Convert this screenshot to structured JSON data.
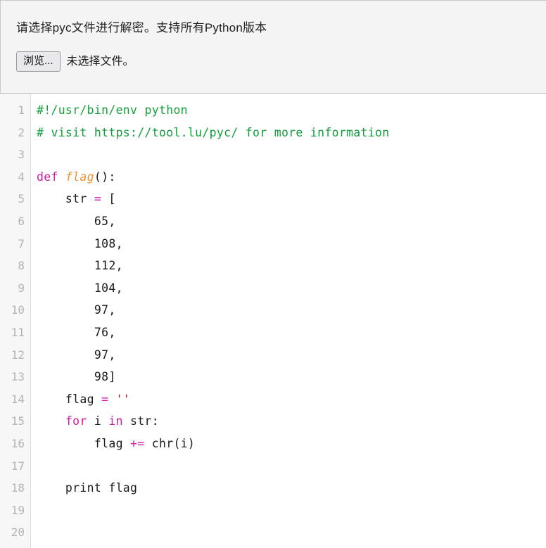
{
  "upload_panel": {
    "heading": "请选择pyc文件进行解密。支持所有Python版本",
    "browse_label": "浏览...",
    "file_status": "未选择文件。"
  },
  "code_viewer": {
    "language": "python",
    "first_line_number": 1,
    "last_line_number": 20,
    "line_numbers": [
      "1",
      "2",
      "3",
      "4",
      "5",
      "6",
      "7",
      "8",
      "9",
      "10",
      "11",
      "12",
      "13",
      "14",
      "15",
      "16",
      "17",
      "18",
      "19",
      "20"
    ],
    "colors": {
      "comment": "#12a03c",
      "keyword": "#d119a8",
      "function_name": "#e89132",
      "operator": "#d119a8",
      "string": "#b02020",
      "plain": "#1b1b1b",
      "gutter_text": "#b3b3b3",
      "gutter_bg": "#f7f7f7",
      "panel_bg": "#f4f4f4"
    },
    "lines": [
      {
        "n": "1",
        "tokens": [
          {
            "t": "#!/usr/bin/env python",
            "c": "comment"
          }
        ]
      },
      {
        "n": "2",
        "tokens": [
          {
            "t": "# visit https://tool.lu/pyc/ for more information",
            "c": "comment"
          }
        ]
      },
      {
        "n": "3",
        "tokens": [
          {
            "t": "",
            "c": "plain"
          }
        ]
      },
      {
        "n": "4",
        "tokens": [
          {
            "t": "def",
            "c": "keyword"
          },
          {
            "t": " ",
            "c": "plain"
          },
          {
            "t": "flag",
            "c": "fname"
          },
          {
            "t": "():",
            "c": "plain"
          }
        ]
      },
      {
        "n": "5",
        "tokens": [
          {
            "t": "    str ",
            "c": "plain"
          },
          {
            "t": "=",
            "c": "op"
          },
          {
            "t": " [",
            "c": "plain"
          }
        ]
      },
      {
        "n": "6",
        "tokens": [
          {
            "t": "        65,",
            "c": "plain"
          }
        ]
      },
      {
        "n": "7",
        "tokens": [
          {
            "t": "        108,",
            "c": "plain"
          }
        ]
      },
      {
        "n": "8",
        "tokens": [
          {
            "t": "        112,",
            "c": "plain"
          }
        ]
      },
      {
        "n": "9",
        "tokens": [
          {
            "t": "        104,",
            "c": "plain"
          }
        ]
      },
      {
        "n": "10",
        "tokens": [
          {
            "t": "        97,",
            "c": "plain"
          }
        ]
      },
      {
        "n": "11",
        "tokens": [
          {
            "t": "        76,",
            "c": "plain"
          }
        ]
      },
      {
        "n": "12",
        "tokens": [
          {
            "t": "        97,",
            "c": "plain"
          }
        ]
      },
      {
        "n": "13",
        "tokens": [
          {
            "t": "        98]",
            "c": "plain"
          }
        ]
      },
      {
        "n": "14",
        "tokens": [
          {
            "t": "    flag ",
            "c": "plain"
          },
          {
            "t": "=",
            "c": "op"
          },
          {
            "t": " ",
            "c": "plain"
          },
          {
            "t": "''",
            "c": "string"
          }
        ]
      },
      {
        "n": "15",
        "tokens": [
          {
            "t": "    ",
            "c": "plain"
          },
          {
            "t": "for",
            "c": "keyword"
          },
          {
            "t": " i ",
            "c": "plain"
          },
          {
            "t": "in",
            "c": "keyword"
          },
          {
            "t": " str:",
            "c": "plain"
          }
        ]
      },
      {
        "n": "16",
        "tokens": [
          {
            "t": "        flag ",
            "c": "plain"
          },
          {
            "t": "+=",
            "c": "op"
          },
          {
            "t": " chr(i)",
            "c": "plain"
          }
        ]
      },
      {
        "n": "17",
        "tokens": [
          {
            "t": "",
            "c": "plain"
          }
        ]
      },
      {
        "n": "18",
        "tokens": [
          {
            "t": "    print flag",
            "c": "plain"
          }
        ]
      },
      {
        "n": "19",
        "tokens": [
          {
            "t": "",
            "c": "plain"
          }
        ]
      },
      {
        "n": "20",
        "tokens": [
          {
            "t": "",
            "c": "plain"
          }
        ]
      }
    ]
  }
}
